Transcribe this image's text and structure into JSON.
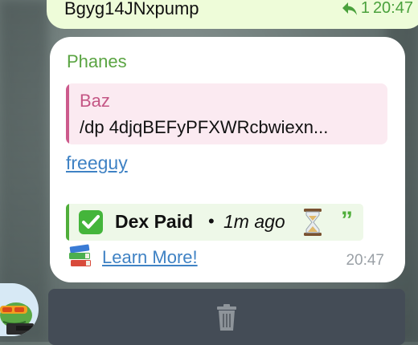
{
  "previous_message": {
    "text": "Bgyg14JNxpump",
    "reply_count": "1",
    "time": "20:47"
  },
  "message": {
    "sender": "Phanes",
    "quote": {
      "name": "Baz",
      "text": "/dp 4djqBEFyPFXWRcbwiexn..."
    },
    "link": "freeguy",
    "embed": {
      "title": "Dex Paid",
      "separator": "•",
      "time": "1m ago",
      "quote_icon": "”"
    },
    "learn_more": "Learn More!",
    "time": "20:47"
  },
  "icons": {
    "reply": "reply-arrow-icon",
    "check": "check-mark-icon",
    "hourglass": "hourglass-icon",
    "books": "books-icon",
    "trash": "trash-icon"
  },
  "colors": {
    "sender": "#5aa442",
    "quote_accent": "#cc5a8c",
    "link": "#3f82c4",
    "embed_accent": "#4fae3a",
    "outgoing_bubble": "#eefcd9"
  }
}
